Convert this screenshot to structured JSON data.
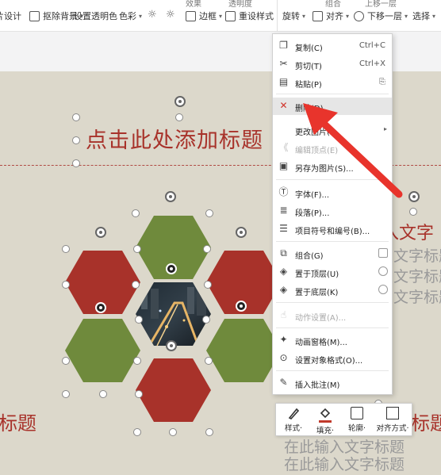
{
  "ribbon": {
    "items": [
      {
        "label": "片设计",
        "has_caret": false
      },
      {
        "label": "抠除背景",
        "has_caret": true
      },
      {
        "label": "设置透明色",
        "has_caret": false
      },
      {
        "label": "色彩",
        "has_caret": true
      },
      {
        "label": "边框",
        "has_caret": true
      },
      {
        "label": "重设样式",
        "has_caret": false
      },
      {
        "label": "旋转",
        "has_caret": true
      },
      {
        "label": "对齐",
        "has_caret": true
      },
      {
        "label": "下移一层",
        "has_caret": true
      },
      {
        "label": "选择",
        "has_caret": true
      }
    ],
    "top_partial": [
      "效果",
      "透明度",
      "组合",
      "上移一层"
    ]
  },
  "slide": {
    "title_placeholder": "点击此处添加标题",
    "left_title": "标题",
    "right_title": "标题",
    "right_texts": [
      "入文字",
      "文字标题",
      "文字标题",
      "文字标题"
    ],
    "bottom_texts": [
      "在此输入文字标题",
      "在此输入文字标题"
    ],
    "colors": {
      "red": "#a8322a",
      "green": "#6f8a3c",
      "bg": "#dcd8cb"
    }
  },
  "context_menu": {
    "items": [
      {
        "icon": "copy-icon",
        "label": "复制(C)",
        "shortcut": "Ctrl+C",
        "disabled": false
      },
      {
        "icon": "scissors-icon",
        "label": "剪切(T)",
        "shortcut": "Ctrl+X",
        "disabled": false
      },
      {
        "icon": "paste-icon",
        "label": "粘贴(P)",
        "shortcut": "",
        "disabled": false
      },
      {
        "icon": "delete-icon",
        "label": "删除(D)",
        "shortcut": "",
        "disabled": false
      },
      {
        "icon": "",
        "label": "更改图片(I)",
        "shortcut": "",
        "disabled": false
      },
      {
        "icon": "edit-vertex-icon",
        "label": "编辑顶点(E)",
        "shortcut": "",
        "disabled": true
      },
      {
        "icon": "save-image-icon",
        "label": "另存为图片(S)...",
        "shortcut": "",
        "disabled": false
      },
      {
        "icon": "font-icon",
        "label": "字体(F)...",
        "shortcut": "",
        "disabled": false
      },
      {
        "icon": "paragraph-icon",
        "label": "段落(P)...",
        "shortcut": "",
        "disabled": false
      },
      {
        "icon": "bullets-icon",
        "label": "项目符号和编号(B)...",
        "shortcut": "",
        "disabled": false
      },
      {
        "icon": "group-icon",
        "label": "组合(G)",
        "shortcut": "",
        "disabled": false
      },
      {
        "icon": "bring-front-icon",
        "label": "置于顶层(U)",
        "shortcut": "",
        "disabled": false
      },
      {
        "icon": "send-back-icon",
        "label": "置于底层(K)",
        "shortcut": "",
        "disabled": false
      },
      {
        "icon": "action-icon",
        "label": "动作设置(A)...",
        "shortcut": "",
        "disabled": true
      },
      {
        "icon": "animation-icon",
        "label": "动画窗格(M)...",
        "shortcut": "",
        "disabled": false
      },
      {
        "icon": "format-icon",
        "label": "设置对象格式(O)...",
        "shortcut": "",
        "disabled": false
      },
      {
        "icon": "comment-icon",
        "label": "插入批注(M)",
        "shortcut": "",
        "disabled": false
      }
    ]
  },
  "mini_toolbar": {
    "items": [
      {
        "label": "样式",
        "caret": "·"
      },
      {
        "label": "填充",
        "caret": "·"
      },
      {
        "label": "轮廓",
        "caret": "·"
      },
      {
        "label": "对齐方式",
        "caret": "·"
      }
    ]
  },
  "annotation": {
    "arrow_color": "#e8342c"
  }
}
